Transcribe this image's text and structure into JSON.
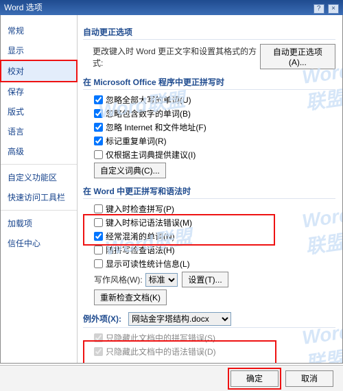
{
  "title": "Word 选项",
  "watermark": "Word联盟",
  "sidebar": {
    "items": [
      {
        "label": "常规"
      },
      {
        "label": "显示"
      },
      {
        "label": "校对"
      },
      {
        "label": "保存"
      },
      {
        "label": "版式"
      },
      {
        "label": "语言"
      },
      {
        "label": "高级"
      },
      {
        "label": "自定义功能区"
      },
      {
        "label": "快速访问工具栏"
      },
      {
        "label": "加载项"
      },
      {
        "label": "信任中心"
      }
    ],
    "selected_index": 2
  },
  "sections": {
    "autocorrect": {
      "title": "自动更正选项",
      "desc": "更改键入时 Word 更正文字和设置其格式的方式:",
      "button": "自动更正选项(A)..."
    },
    "office_spell": {
      "title": "在 Microsoft Office 程序中更正拼写时",
      "opts": [
        {
          "label": "忽略全部大写的单词(U)",
          "checked": true
        },
        {
          "label": "忽略包含数字的单词(B)",
          "checked": true
        },
        {
          "label": "忽略 Internet 和文件地址(F)",
          "checked": true
        },
        {
          "label": "标记重复单词(R)",
          "checked": true
        },
        {
          "label": "仅根据主词典提供建议(I)",
          "checked": false
        }
      ],
      "dict_button": "自定义词典(C)..."
    },
    "word_spell": {
      "title": "在 Word 中更正拼写和语法时",
      "opts": [
        {
          "label": "键入时检查拼写(P)",
          "checked": false
        },
        {
          "label": "键入时标记语法错误(M)",
          "checked": false
        },
        {
          "label": "经常混淆的单词(N)",
          "checked": true
        },
        {
          "label": "随拼写检查语法(H)",
          "checked": false
        },
        {
          "label": "显示可读性统计信息(L)",
          "checked": false
        }
      ],
      "style_label": "写作风格(W):",
      "style_value": "标准",
      "settings_button": "设置(T)...",
      "recheck_button": "重新检查文档(K)"
    },
    "exceptions": {
      "title": "例外项(X):",
      "doc": "网站金字塔结构.docx",
      "opts": [
        {
          "label": "只隐藏此文档中的拼写错误(S)",
          "checked": true,
          "disabled": true
        },
        {
          "label": "只隐藏此文档中的语法错误(D)",
          "checked": true,
          "disabled": true
        }
      ]
    }
  },
  "footer": {
    "ok": "确定",
    "cancel": "取消"
  }
}
